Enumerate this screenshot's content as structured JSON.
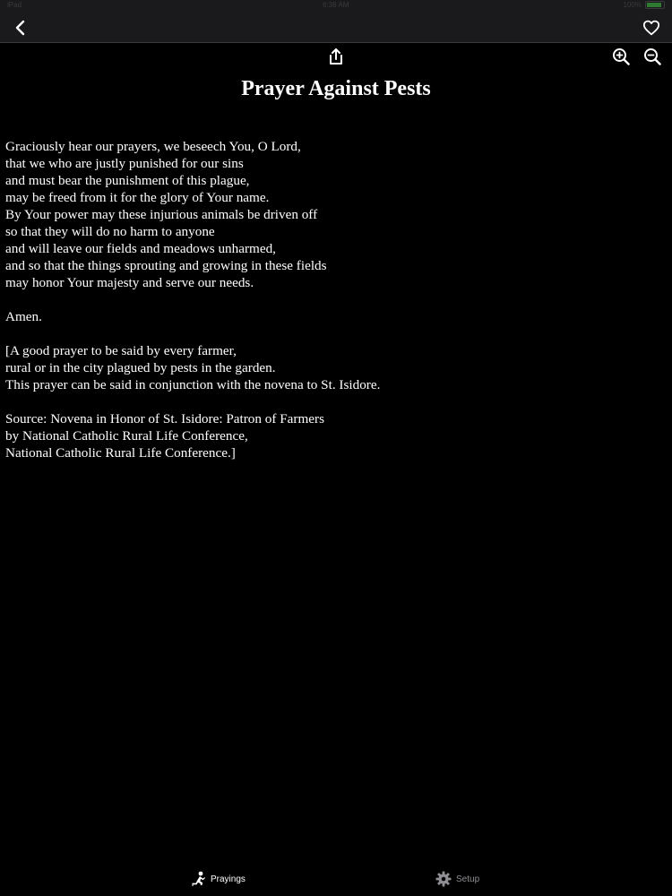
{
  "status_bar": {
    "carrier": "iPad",
    "time": "6:38 AM",
    "battery": "100%"
  },
  "nav": {
    "back_icon": "chevron-left-icon",
    "favorite_icon": "heart-outline-icon"
  },
  "toolbar": {
    "share_icon": "share-icon",
    "zoom_in_icon": "zoom-in-icon",
    "zoom_out_icon": "zoom-out-icon"
  },
  "prayer": {
    "title": "Prayer Against Pests",
    "paragraphs": [
      [
        "Graciously hear our prayers, we beseech You, O Lord,",
        "that we who are justly punished for our sins",
        "and must bear the punishment of this plague,",
        "may be freed from it for the glory of Your name.",
        "By Your power may these injurious animals be driven off",
        "so that they will do no harm to anyone",
        "and will leave our fields and meadows unharmed,",
        "and so that the things sprouting and growing in these fields",
        "may honor Your majesty and serve our needs."
      ],
      [
        "Amen."
      ],
      [
        "[A good prayer to be said by every farmer,",
        "rural or in the city plagued by pests in the garden.",
        "This prayer can be said in conjunction with the novena to St. Isidore."
      ],
      [
        "Source: Novena in Honor of St. Isidore: Patron of Farmers",
        "by National Catholic Rural Life Conference,",
        "National Catholic Rural Life Conference.]"
      ]
    ]
  },
  "tabs": [
    {
      "label": "Prayings",
      "icon": "kneeling-person-icon",
      "active": true
    },
    {
      "label": "Setup",
      "icon": "gear-icon",
      "active": false
    }
  ],
  "colors": {
    "background": "#000000",
    "bar": "#1a1a1c",
    "text": "#ffffff",
    "inactive_tab": "#8e8e93"
  }
}
